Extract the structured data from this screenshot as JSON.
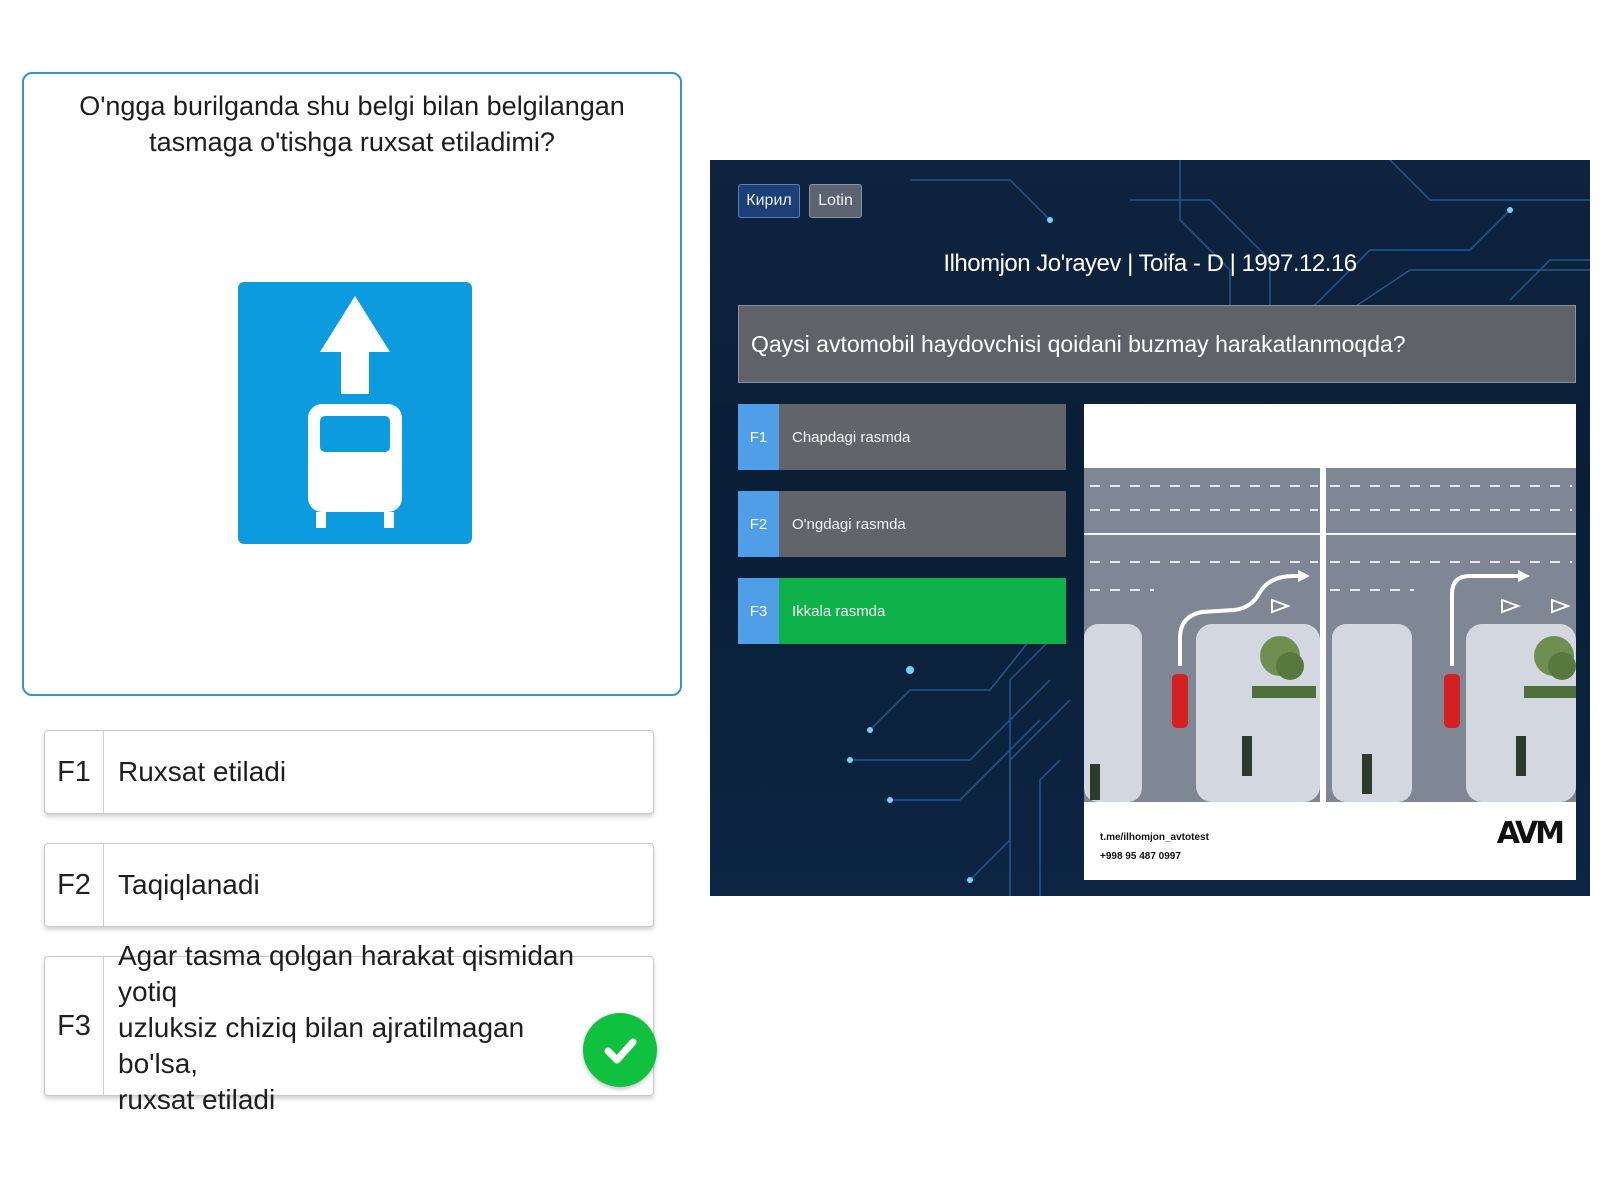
{
  "question": {
    "text_line1": "O'ngga burilganda shu belgi bilan belgilangan",
    "text_line2": "tasmaga o'tishga ruxsat etiladimi?",
    "sign_icon": "bus-lane-sign-icon",
    "sign_color": "#0d9be0"
  },
  "answers": [
    {
      "key": "F1",
      "text": "Ruxsat etiladi"
    },
    {
      "key": "F2",
      "text": "Taqiqlanadi"
    },
    {
      "key": "F3",
      "text_line1": "Agar tasma qolgan harakat qismidan yotiq",
      "text_line2": "uzluksiz chiziq bilan ajratilmagan bo'lsa,",
      "text_line3": "ruxsat etiladi",
      "correct": true
    }
  ],
  "colors": {
    "correct_check": "#10c13f",
    "card_border": "#3a8fd0"
  },
  "screenshot": {
    "lang_buttons": [
      "Кирил",
      "Lotin"
    ],
    "user_info": "Ilhomjon Jo'rayev | Toifa - D | 1997.12.16",
    "question": "Qaysi avtomobil haydovchisi qoidani buzmay harakatlanmoqda?",
    "options": [
      {
        "key": "F1",
        "text": "Chapdagi rasmda"
      },
      {
        "key": "F2",
        "text": "O'ngdagi rasmda"
      },
      {
        "key": "F3",
        "text": "Ikkala rasmda",
        "selected": true
      }
    ],
    "footer_link": "t.me/ilhomjon_avtotest",
    "footer_phone": "+998 95 487 0997",
    "logo": "AVM"
  }
}
